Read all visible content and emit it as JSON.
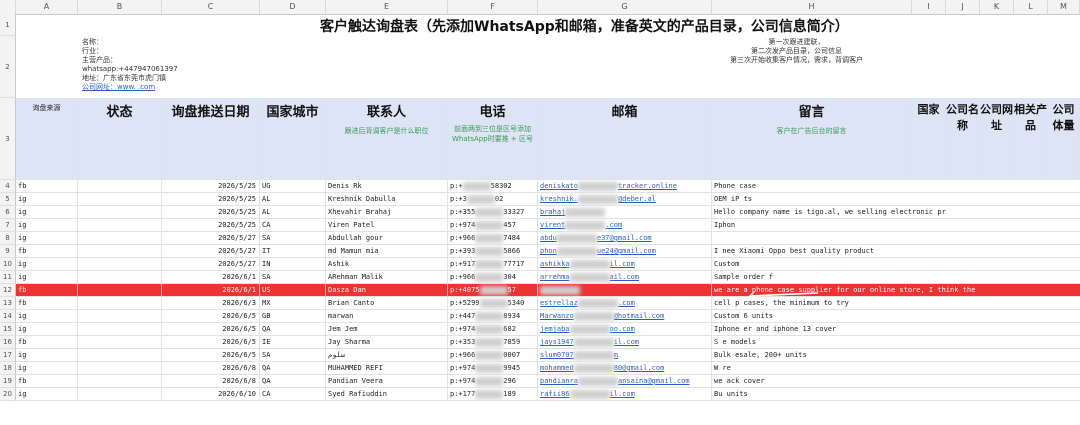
{
  "title": "客户触达询盘表（先添加WhatsApp和邮箱，准备英文的产品目录，公司信息简介）",
  "columns": [
    "A",
    "B",
    "C",
    "D",
    "E",
    "F",
    "G",
    "H",
    "I",
    "J",
    "K",
    "L",
    "M"
  ],
  "company_info": [
    "名称：",
    "行业：",
    "主营产品：",
    "whatsapp:+447947061397",
    "地址：广东省东莞市虎门镇",
    "公司网址：www.           .com"
  ],
  "followup_notes": [
    "第一次跟进建联，",
    "第二次发产品目录，公司信息",
    "第三次开始收集客户情况，需求，背调客户"
  ],
  "headers": {
    "source": "询盘来源",
    "status": "状态",
    "date": "询盘推送日期",
    "country": "国家城市",
    "contact": "联系人",
    "contact_hint": "跟进后背调客户是什么职位",
    "phone": "电话",
    "phone_hint": "前面两到三位是区号添加WhatsApp时要推 + 区号",
    "email": "邮箱",
    "message": "留言",
    "message_hint": "客户在广告后台的留言",
    "country2": "国家",
    "company_name": "公司名称",
    "company_site": "公司网址",
    "related_products": "相关产品",
    "company_size": "公司体量"
  },
  "rows": [
    {
      "n": "4",
      "src": "fb",
      "date": "2026/5/25",
      "cc": "UG",
      "name": "Denis Rk",
      "phone": "p:+",
      "ph2": "58302",
      "email": "deniskato",
      "em2": "tracker.online",
      "msg": "Phone case"
    },
    {
      "n": "5",
      "src": "ig",
      "date": "2026/5/25",
      "cc": "AL",
      "name": "Kreshnik Dabulla",
      "phone": "p:+3",
      "ph2": "02",
      "email": "kreshnik.",
      "em2": "@deber.al",
      "msg": "OEM iP          ts"
    },
    {
      "n": "6",
      "src": "ig",
      "date": "2026/5/25",
      "cc": "AL",
      "name": "Xhevahir Brahaj",
      "phone": "p:+355",
      "ph2": "33327",
      "email": "brahaj",
      "em2": "",
      "msg": "Hello            company name is tigo.al, we selling electronic pr"
    },
    {
      "n": "7",
      "src": "ig",
      "date": "2026/5/25",
      "cc": "CA",
      "name": "Viren Patel",
      "phone": "p:+974",
      "ph2": "457",
      "email": "virent",
      "em2": ".com",
      "msg": "Iphon"
    },
    {
      "n": "8",
      "src": "ig",
      "date": "2026/5/27",
      "cc": "SA",
      "name": "Abdullah gour",
      "phone": "p:+966",
      "ph2": "7484",
      "email": "abdu",
      "em2": "e37@gmail.com",
      "msg": ""
    },
    {
      "n": "9",
      "src": "fb",
      "date": "2026/5/27",
      "cc": "IT",
      "name": "md Mamun mia",
      "phone": "p:+393",
      "ph2": "5866",
      "email": "phon",
      "em2": "ue24@gmail.com",
      "msg": "I nee            Xiaomi Oppo best quality product"
    },
    {
      "n": "10",
      "src": "ig",
      "date": "2026/5/27",
      "cc": "IN",
      "name": "Ashik",
      "phone": "p:+917",
      "ph2": "77717",
      "email": "ashikka",
      "em2": "il.com",
      "msg": "Custom"
    },
    {
      "n": "11",
      "src": "ig",
      "date": "2026/6/1",
      "cc": "SA",
      "name": "ARehman Malik",
      "phone": "p:+966",
      "ph2": "304",
      "email": "arrehma",
      "em2": "ail.com",
      "msg": "Sample order f"
    },
    {
      "n": "12",
      "src": "fb",
      "date": "2026/6/1",
      "cc": "US",
      "name": "Dasza Dan",
      "phone": "p:+4075",
      "ph2": "57",
      "email": "",
      "em2": "",
      "msg": "we are           a phone case supplier for our online store, I think the",
      "hl": true
    },
    {
      "n": "13",
      "src": "fb",
      "date": "2026/6/3",
      "cc": "MX",
      "name": "Brian Canto",
      "phone": "p:+5299",
      "ph2": "5340",
      "email": "estrellaz",
      "em2": ".com",
      "msg": "cell p      cases, the minimum to try"
    },
    {
      "n": "14",
      "src": "ig",
      "date": "2026/6/5",
      "cc": "GB",
      "name": "marwan",
      "phone": "p:+447",
      "ph2": "8934",
      "email": "Marwanzo",
      "em2": "@hotmail.com",
      "msg": "Custom 6      units"
    },
    {
      "n": "15",
      "src": "ig",
      "date": "2026/6/5",
      "cc": "QA",
      "name": "Jem Jem",
      "phone": "p:+974",
      "ph2": "682",
      "email": "jemjaba",
      "em2": "oo.com",
      "msg": "Iphone         er and iphone 13 cover"
    },
    {
      "n": "16",
      "src": "fb",
      "date": "2026/6/5",
      "cc": "IE",
      "name": "Jay Sharma",
      "phone": "p:+353",
      "ph2": "7859",
      "email": "jays1947",
      "em2": "il.com",
      "msg": "S            e models"
    },
    {
      "n": "17",
      "src": "ig",
      "date": "2026/6/5",
      "cc": "SA",
      "name": "سلوم",
      "phone": "p:+966",
      "ph2": "0007",
      "email": "slum0707",
      "em2": "m",
      "msg": "Bulk       esale, 200+ units"
    },
    {
      "n": "18",
      "src": "ig",
      "date": "2026/6/8",
      "cc": "QA",
      "name": "MUHAMMED REFI",
      "phone": "p:+974",
      "ph2": "9945",
      "email": "mohammed",
      "em2": "80@gmail.com",
      "msg": "W             re"
    },
    {
      "n": "19",
      "src": "fb",
      "date": "2026/6/8",
      "cc": "QA",
      "name": "Pandian Veera",
      "phone": "p:+974",
      "ph2": "296",
      "email": "pandianra",
      "em2": "ansaina@gmail.com",
      "msg": "we     ack cover"
    },
    {
      "n": "20",
      "src": "ig",
      "date": "2026/6/10",
      "cc": "CA",
      "name": "Syed Rafiuddin",
      "phone": "p:+177",
      "ph2": "189",
      "email": "rafii86",
      "em2": "il.com",
      "msg": "Bu      units"
    }
  ]
}
